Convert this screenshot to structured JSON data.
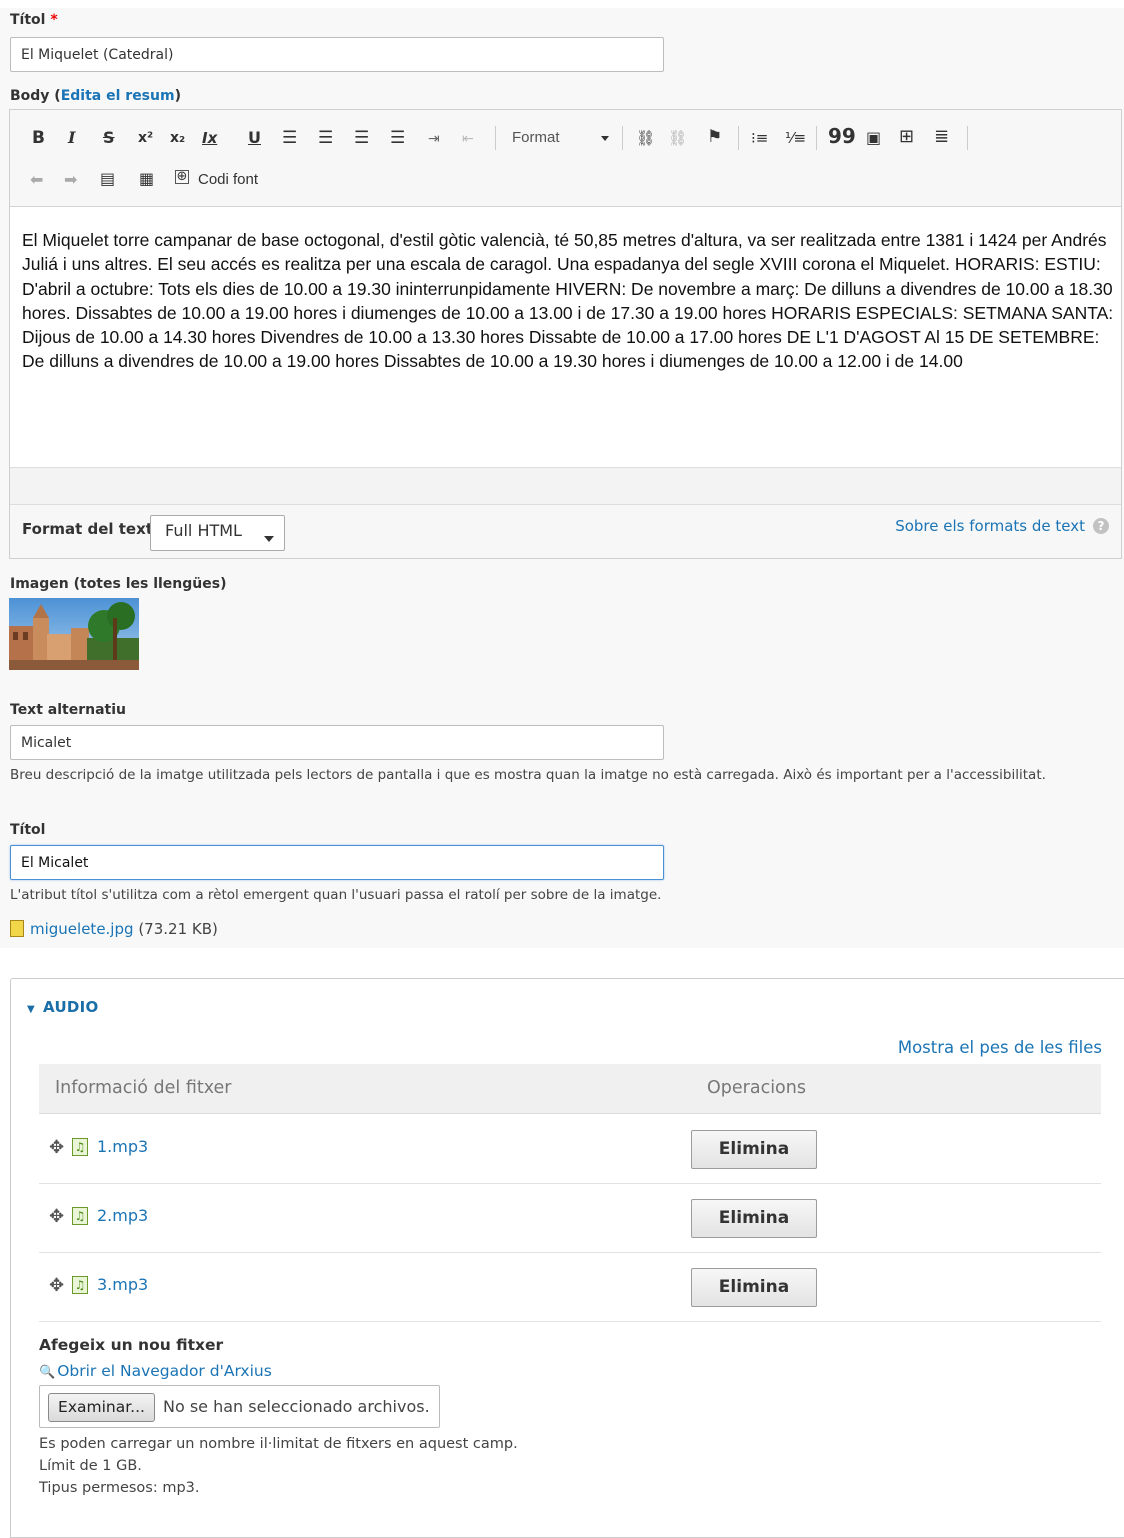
{
  "title_field": {
    "label": "Títol",
    "required_mark": "*",
    "value": "El Miquelet (Catedral)"
  },
  "body_field": {
    "label_prefix": "Body (",
    "summary_link": "Edita el resum",
    "label_suffix": ")"
  },
  "toolbar": {
    "row1": [
      "bold-icon",
      "italic-icon",
      "strikethrough-icon",
      "superscript-icon",
      "subscript-icon",
      "remove-format-icon",
      "underline-icon",
      "align-left-icon",
      "align-center-icon",
      "align-right-icon",
      "align-justify-icon",
      "indent-icon",
      "outdent-icon",
      "link-icon",
      "unlink-icon",
      "anchor-icon",
      "bulleted-list-icon",
      "numbered-list-icon",
      "blockquote-icon",
      "image-icon",
      "table-icon",
      "horizontal-rule-icon"
    ],
    "format_label": "Format",
    "source_label": "Codi font"
  },
  "body_text": "El Miquelet torre campanar de base octogonal, d'estil gòtic valencià, té 50,85 metres d'altura, va ser realitzada entre 1381 i 1424 per Andrés Juliá i uns altres. El seu accés es realitza per una escala de caragol. Una espadanya del segle XVIII corona el Miquelet. HORARIS: ESTIU: D'abril a octubre: Tots els dies de 10.00 a 19.30 ininterrunpidamente HIVERN: De novembre a març: De dilluns a divendres de 10.00 a 18.30 hores. Dissabtes de 10.00 a 19.00 hores i diumenges de 10.00 a 13.00 i de 17.30 a 19.00 hores HORARIS ESPECIALS: SETMANA SANTA: Dijous de 10.00 a 14.30 hores Divendres de 10.00 a 13.30 hores Dissabte de 10.00 a 17.00 hores DE L'1 D'AGOST Al 15 DE SETEMBRE: De dilluns a divendres de 10.00 a 19.00 hores Dissabtes de 10.00 a 19.30 hores i diumenges de 10.00 a 12.00 i de 14.00",
  "text_format": {
    "label": "Format del text",
    "selected": "Full HTML",
    "about_link": "Sobre els formats de text"
  },
  "image_field": {
    "label": "Imagen (totes les llengües)",
    "alt_label": "Text alternatiu",
    "alt_value": "Micalet",
    "alt_desc": "Breu descripció de la imatge utilitzada pels lectors de pantalla i que es mostra quan la imatge no està carregada. Això és important per a l'accessibilitat.",
    "title_label": "Títol",
    "title_value": "El Micalet",
    "title_desc": "L'atribut títol s'utilitza com a rètol emergent quan l'usuari passa el ratolí per sobre de la imatge.",
    "file_name": "miguelete.jpg",
    "file_size": "(73.21 KB)"
  },
  "audio": {
    "title": "AUDIO",
    "show_weights": "Mostra el pes de les files",
    "col_info": "Informació del fitxer",
    "col_ops": "Operacions",
    "files": [
      {
        "name": "1.mp3",
        "action": "Elimina"
      },
      {
        "name": "2.mp3",
        "action": "Elimina"
      },
      {
        "name": "3.mp3",
        "action": "Elimina"
      }
    ],
    "add_label": "Afegeix un nou fitxer",
    "browser_link": "Obrir el Navegador d'Arxius",
    "browse_button": "Examinar...",
    "no_file": "No se han seleccionado archivos.",
    "help1": "Es poden carregar un nombre il·limitat de fitxers en aquest camp.",
    "help2": "Límit de 1 GB.",
    "help3": "Tipus permesos: mp3."
  },
  "colors": {
    "link": "#1a74b5",
    "required": "#ee0000",
    "focus": "#4b8fd6"
  }
}
